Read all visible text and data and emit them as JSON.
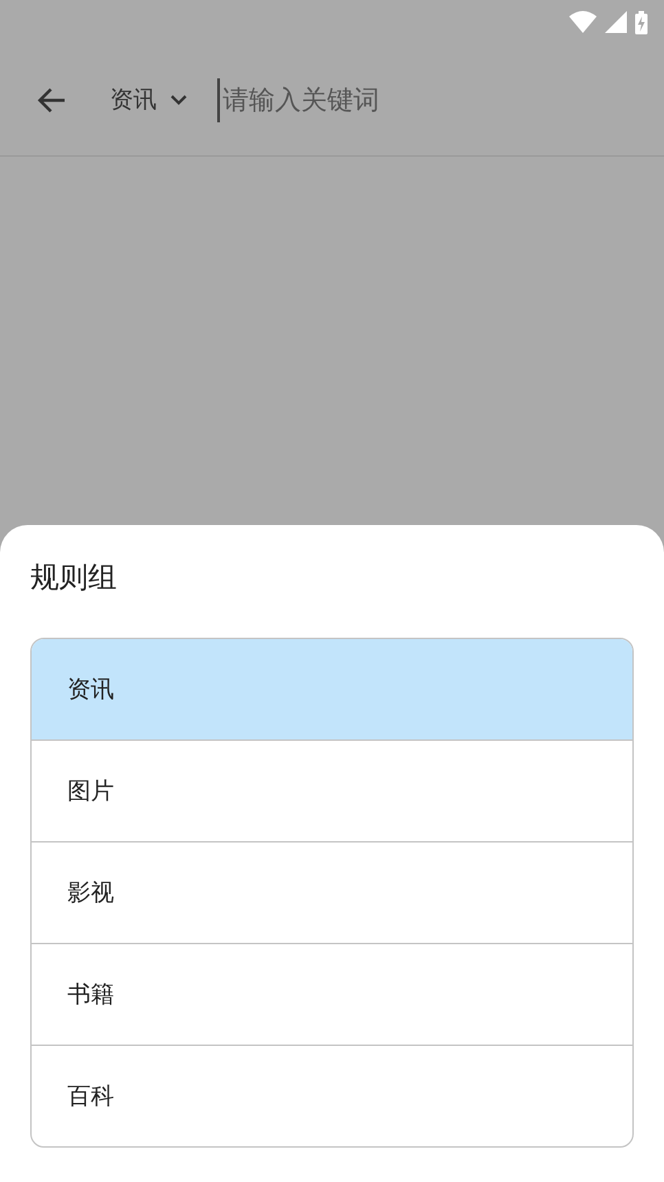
{
  "search_bar": {
    "category": "资讯",
    "placeholder": "请输入关键词"
  },
  "sheet": {
    "title": "规则组",
    "items": [
      {
        "label": "资讯",
        "selected": true
      },
      {
        "label": "图片",
        "selected": false
      },
      {
        "label": "影视",
        "selected": false
      },
      {
        "label": "书籍",
        "selected": false
      },
      {
        "label": "百科",
        "selected": false
      }
    ]
  }
}
